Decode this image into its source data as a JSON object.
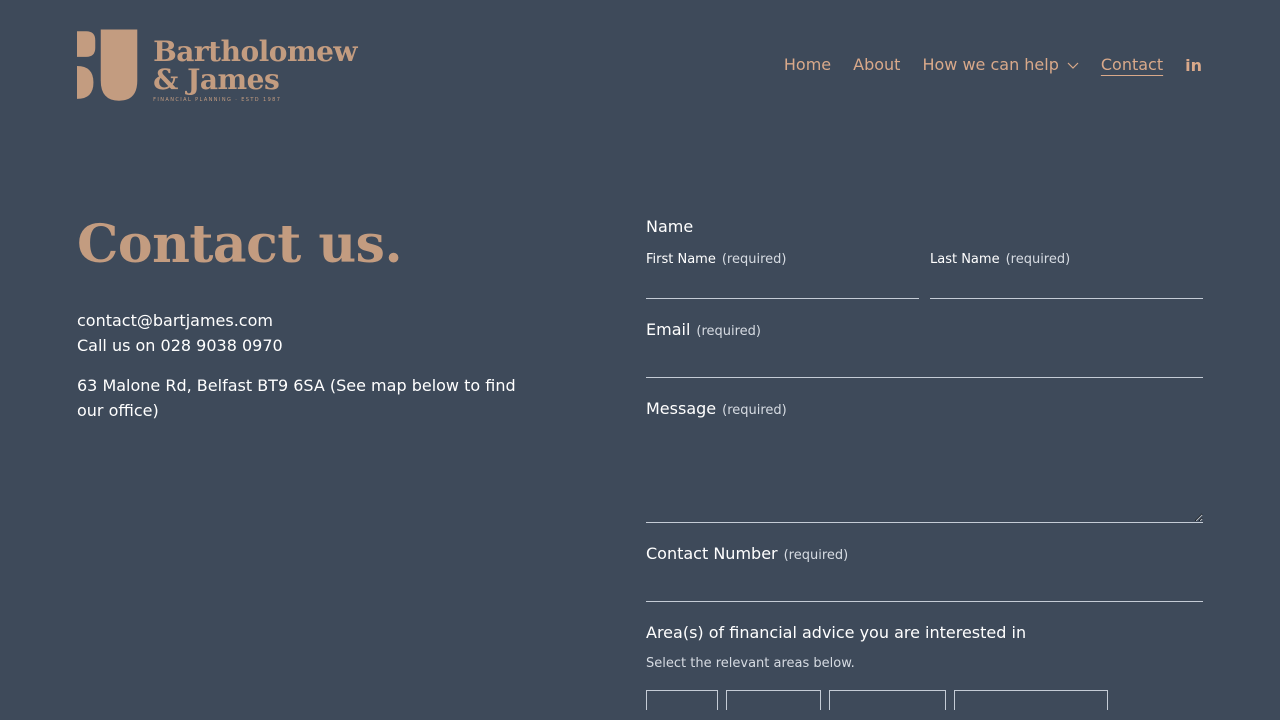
{
  "brand": {
    "line1": "Bartholomew",
    "line2": "& James",
    "tagline": "FINANCIAL PLANNING · ESTD 1987",
    "color": "#c39c80"
  },
  "nav": {
    "items": [
      "Home",
      "About",
      "How we can help",
      "Contact"
    ],
    "active": "Contact",
    "social_icon": "in"
  },
  "page": {
    "title": "Contact us.",
    "email": "contact@bartjames.com",
    "phone": "Call us on 028 9038 0970",
    "address": "63 Malone Rd, Belfast BT9 6SA (See map below to find our office)"
  },
  "form": {
    "name_label": "Name",
    "first_name_label": "First Name",
    "last_name_label": "Last Name",
    "required_text": "(required)",
    "email_label": "Email",
    "message_label": "Message",
    "contact_number_label": "Contact Number",
    "areas_label": "Area(s) of financial advice you are interested in",
    "areas_help": "Select the relevant areas below."
  },
  "colors": {
    "background": "#3e4a5a",
    "accent": "#d9a98a",
    "field_line": "#c5ccd6"
  }
}
